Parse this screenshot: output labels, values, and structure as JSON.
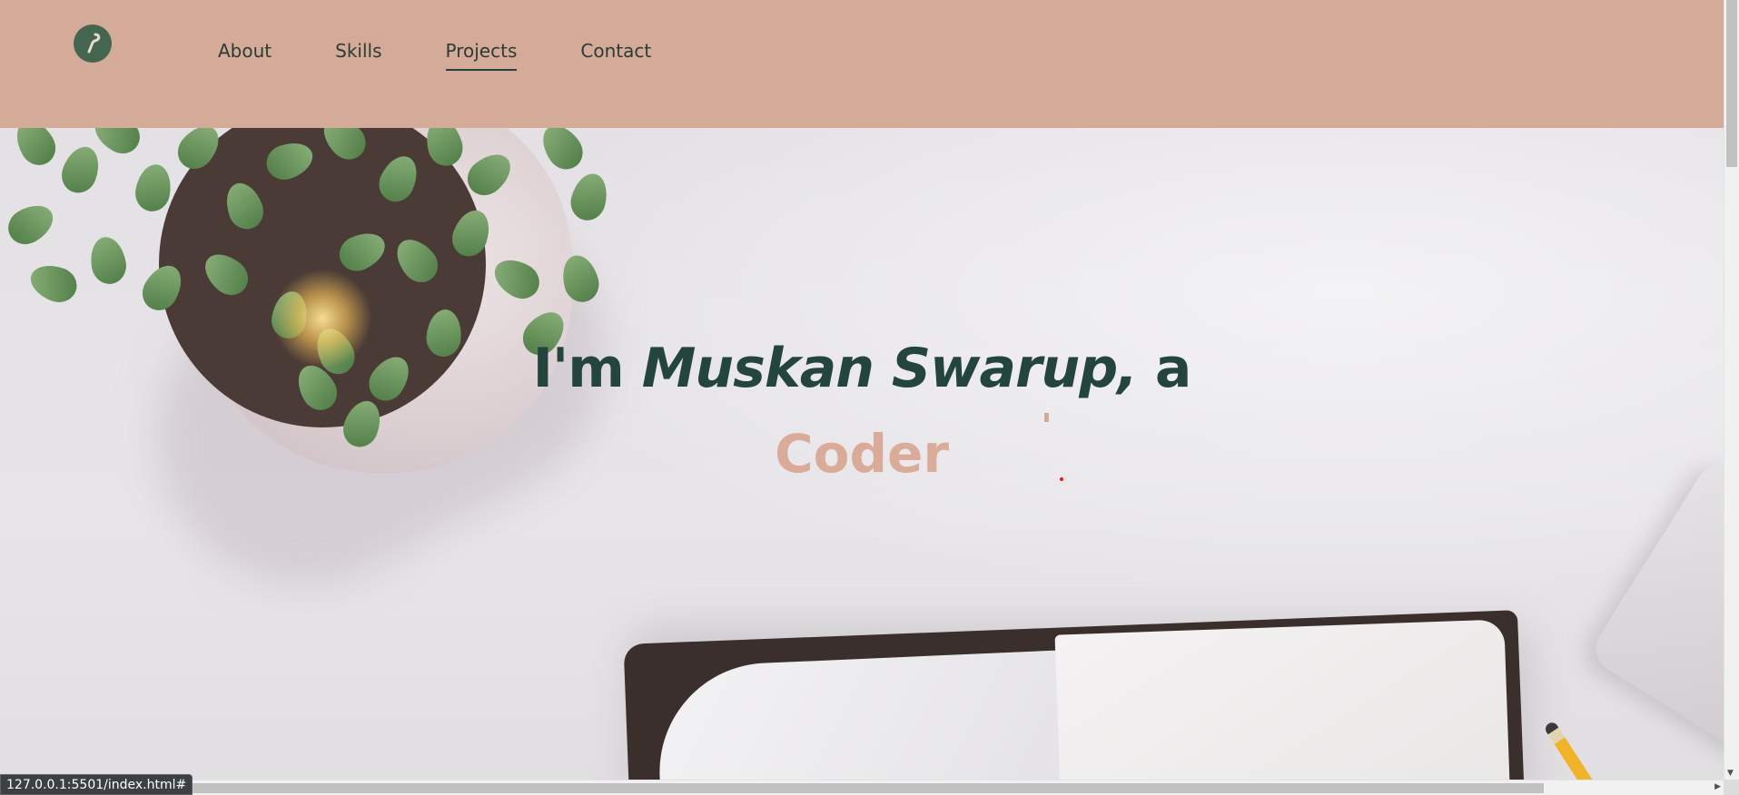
{
  "header": {
    "logo_icon": "feather-brush-logo-icon",
    "nav": [
      {
        "label": "About",
        "active": false
      },
      {
        "label": "Skills",
        "active": false
      },
      {
        "label": "Projects",
        "active": true
      },
      {
        "label": "Contact",
        "active": false
      }
    ]
  },
  "hero": {
    "title_prefix": "I'm ",
    "title_name": "Muskan Swarup,",
    "title_suffix": " a",
    "subtitle": "Coder"
  },
  "status_bar": {
    "url": "127.0.0.1:5501/index.html#"
  },
  "colors": {
    "header_bg": "#d4ab98",
    "title_color": "#24443e",
    "subtitle_color": "#d9ab98",
    "logo_bg": "#44654f"
  }
}
